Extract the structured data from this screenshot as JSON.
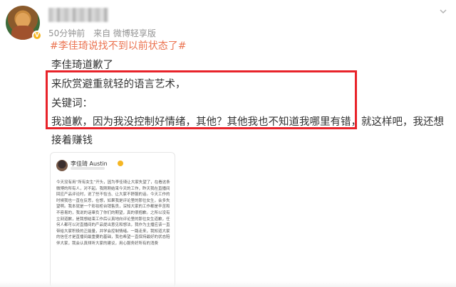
{
  "post": {
    "meta": {
      "time": "50分钟前",
      "source": "来自 微博轻享版"
    },
    "hashtag": "#李佳琦说找不到以前状态了#",
    "lines": [
      "李佳琦道歉了",
      "来欣赏避重就轻的语言艺术，",
      "关键词：",
      "我道歉，因为我没控制好情绪，其他？其他我也不知道我哪里有错，就这样吧，我还想",
      "接着赚钱"
    ],
    "highlight_color": "#e8232a",
    "hashtag_color": "#eb7350"
  },
  "embed": {
    "name": "李佳琦 Austin",
    "text": "今天没有用“所有女生”开头，因为李佳琦让大家失望了，在看这条微博的所有人，对不起。我刚刚结束今天的工作，昨天我在直播间回应产品评论时，说了些不恰当、让大家不舒服的话。今天工作的时候我也一直在反思，在想，如果我是评论里的那位女生，会多失望啊。我本就是一个彩妆柜台销售员，深知大家的工作都是辛苦和不容易的，我说的话辜负了你们的期望，真的很抱歉。之所以没有立刻道歉，是我想结束工作后认真地向评论里的那位女生道歉，任何人都可以对直播间的产品提出意见和想法，我作为主播应该一直带给大家积极的正能量，并学会控制情绪。一路走来，我知道大家的信任才是直播间最重要的基础，我也希望一直保持最好的状态陪伴大家，我会认真倾听大家的建议，用心服务好所有的消费"
  },
  "icons": {
    "verify": "verified-badge-icon",
    "menu": "chevron-down-icon"
  }
}
